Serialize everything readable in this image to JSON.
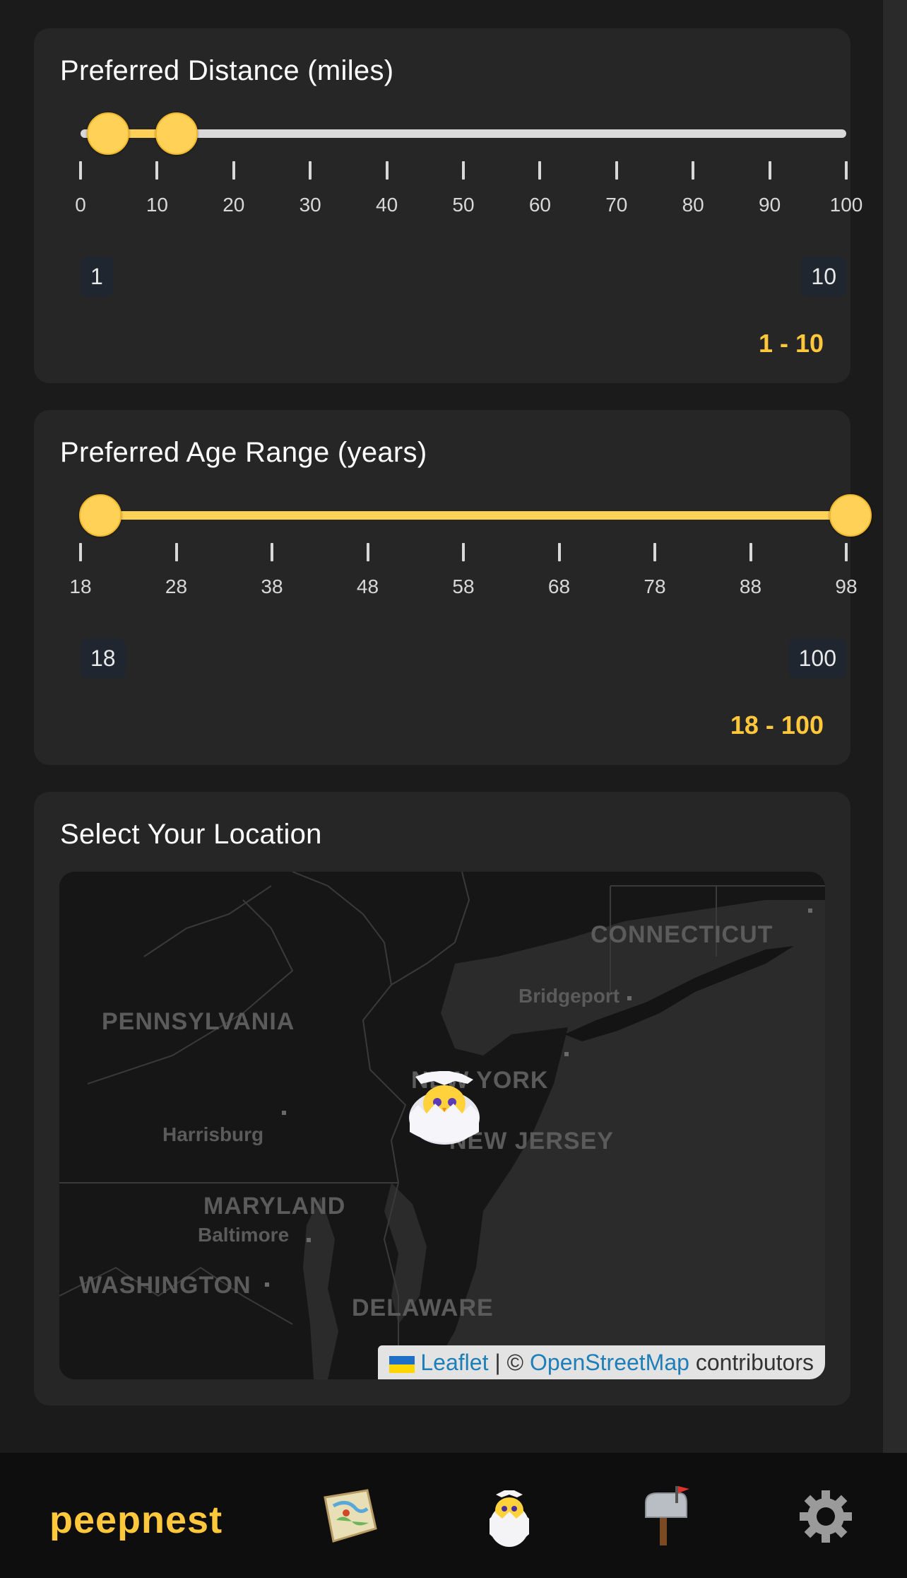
{
  "distance": {
    "title": "Preferred Distance (miles)",
    "min": 0,
    "max": 100,
    "low": 1,
    "high": 10,
    "tick_labels": [
      "0",
      "10",
      "20",
      "30",
      "40",
      "50",
      "60",
      "70",
      "80",
      "90",
      "100"
    ],
    "low_label": "1",
    "high_label": "10",
    "range_text": "1 - 10"
  },
  "age": {
    "title": "Preferred Age Range (years)",
    "min": 18,
    "max": 100,
    "low": 18,
    "high": 100,
    "tick_labels": [
      "18",
      "28",
      "38",
      "48",
      "58",
      "68",
      "78",
      "88",
      "98"
    ],
    "low_label": "18",
    "high_label": "100",
    "range_text": "18 - 100"
  },
  "location": {
    "title": "Select Your Location",
    "map_labels": {
      "connecticut": "CONNECTICUT",
      "bridgeport": "Bridgeport",
      "pennsylvania": "PENNSYLVANIA",
      "new_york": "NEW YORK",
      "harrisburg": "Harrisburg",
      "new_jersey": "NEW JERSEY",
      "maryland": "MARYLAND",
      "baltimore": "Baltimore",
      "washington": "WASHINGTON",
      "delaware": "DELAWARE"
    },
    "attribution": {
      "leaflet": "Leaflet",
      "separator": "| ©",
      "osm": "OpenStreetMap",
      "contributors": "contributors"
    }
  },
  "nav": {
    "brand": "peepnest",
    "icons": [
      "map-scroll-icon",
      "hatching-chick-icon",
      "mailbox-icon",
      "gear-icon"
    ]
  },
  "colors": {
    "accent": "#ffc73b",
    "thumb": "#ffd257",
    "card": "#262626",
    "background": "#1b1b1b"
  }
}
